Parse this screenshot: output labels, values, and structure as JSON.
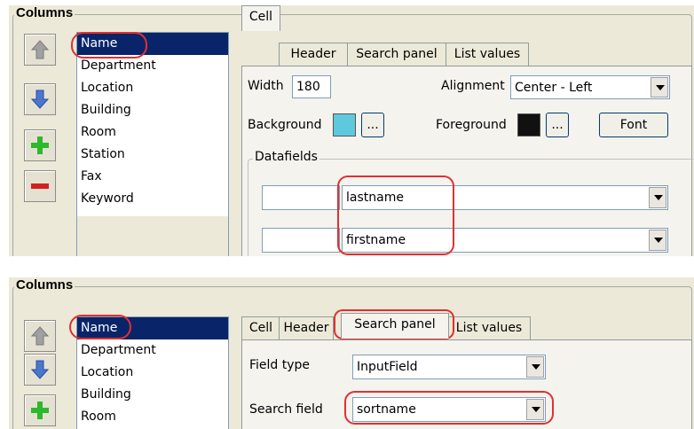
{
  "colors": {
    "highlight": "#e03030",
    "selection": "#0a246a",
    "background_swatch": "#5ec9dc",
    "foreground_swatch": "#111111"
  },
  "top": {
    "group_title": "Columns",
    "buttons": [
      {
        "name": "move-up",
        "icon": "arrow-up-icon"
      },
      {
        "name": "move-down",
        "icon": "arrow-down-icon"
      },
      {
        "name": "add",
        "icon": "plus-icon"
      },
      {
        "name": "remove",
        "icon": "minus-icon"
      }
    ],
    "columns": [
      "Name",
      "Department",
      "Location",
      "Building",
      "Room",
      "Station",
      "Fax",
      "Keyword"
    ],
    "selected_column": "Name",
    "tabs": [
      "Cell",
      "Header",
      "Search panel",
      "List values"
    ],
    "active_tab": "Cell",
    "width_label": "Width",
    "width_value": "180",
    "alignment_label": "Alignment",
    "alignment_value": "Center - Left",
    "background_label": "Background",
    "foreground_label": "Foreground",
    "ellipsis": "...",
    "font_button": "Font",
    "datafields_title": "Datafields",
    "datafields": [
      {
        "prefix": "",
        "field": "lastname"
      },
      {
        "prefix": "",
        "field": "firstname"
      }
    ]
  },
  "bottom": {
    "group_title": "Columns",
    "columns": [
      "Name",
      "Department",
      "Location",
      "Building",
      "Room"
    ],
    "selected_column": "Name",
    "tabs": [
      "Cell",
      "Header",
      "Search panel",
      "List values"
    ],
    "active_tab": "Search panel",
    "field_type_label": "Field type",
    "field_type_value": "InputField",
    "search_field_label": "Search field",
    "search_field_value": "sortname"
  }
}
